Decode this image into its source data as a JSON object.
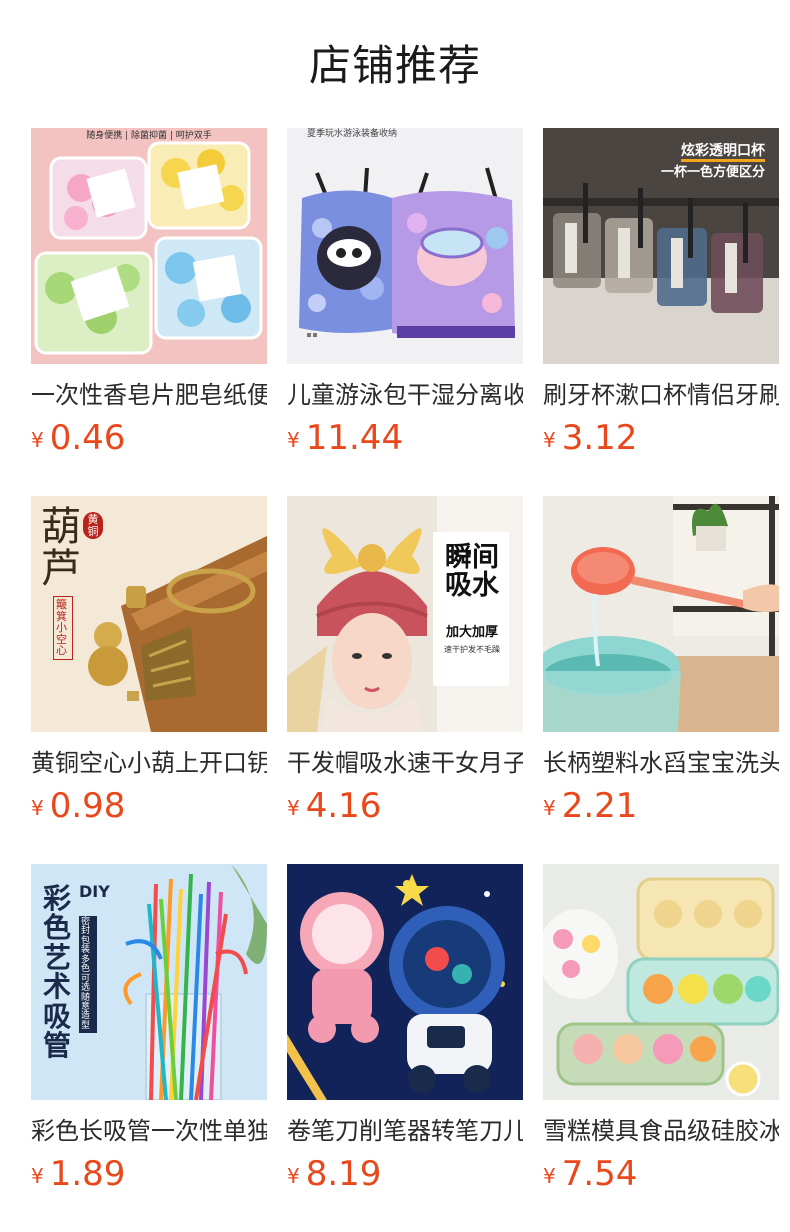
{
  "page": {
    "title": "店铺推荐"
  },
  "currency_symbol": "¥",
  "colors": {
    "price": "#e8481c",
    "text": "#2b2b2b"
  },
  "products": [
    {
      "name": "一次性香皂片肥皂纸便携",
      "price": "0.46",
      "image": {
        "icon": "soap-paper-boxes-image",
        "caption": "随身便携 | 除菌抑菌 | 呵护双手"
      }
    },
    {
      "name": "儿童游泳包干湿分离收纳",
      "price": "11.44",
      "image": {
        "icon": "swim-drawstring-bags-image",
        "caption": "夏季玩水游泳装备收纳"
      }
    },
    {
      "name": "刷牙杯漱口杯情侣牙刷杯",
      "price": "3.12",
      "image": {
        "icon": "toothbrush-cups-image",
        "caption": "炫彩透明口杯",
        "caption2": "一杯一色方便区分"
      }
    },
    {
      "name": "黄铜空心小葫上开口钥匙扣",
      "price": "0.98",
      "image": {
        "icon": "brass-gourd-keychain-image",
        "caption": "葫芦",
        "caption2": "黄铜",
        "caption3": "簸箕小空心"
      }
    },
    {
      "name": "干发帽吸水速干女月子帽",
      "price": "4.16",
      "image": {
        "icon": "hair-drying-cap-image",
        "caption": "瞬间吸水",
        "caption2": "加大加厚",
        "caption3": "速干护发不毛躁"
      }
    },
    {
      "name": "长柄塑料水舀宝宝洗头",
      "price": "2.21",
      "image": {
        "icon": "water-ladle-basin-image"
      }
    },
    {
      "name": "彩色长吸管一次性单独包装",
      "price": "1.89",
      "image": {
        "icon": "colorful-straws-image",
        "caption": "彩色艺术吸管",
        "caption2": "DIY",
        "caption3": "密封包装 多色可选 随意造型"
      }
    },
    {
      "name": "卷笔刀削笔器转笔刀儿童",
      "price": "8.19",
      "image": {
        "icon": "astronaut-pencil-sharpener-image"
      }
    },
    {
      "name": "雪糕模具食品级硅胶冰棍",
      "price": "7.54",
      "image": {
        "icon": "popsicle-molds-image"
      }
    }
  ]
}
